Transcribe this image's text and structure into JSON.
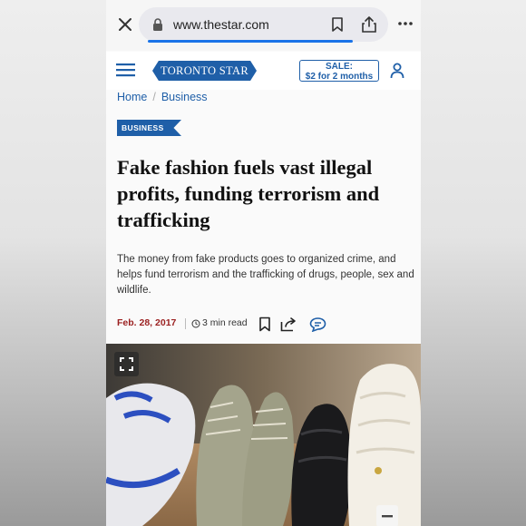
{
  "browser": {
    "url": "www.thestar.com",
    "icons": [
      "close-icon",
      "lock-icon",
      "bookmark-icon",
      "share-icon",
      "more-icon"
    ],
    "progress": 0.82
  },
  "header": {
    "logo_text": "TORONTO STAR",
    "sale_line1": "SALE:",
    "sale_line2": "$2 for 2 months",
    "brand_color": "#1f5fa8"
  },
  "breadcrumb": {
    "home": "Home",
    "separator": "/",
    "section": "Business"
  },
  "article": {
    "tag": "BUSINESS",
    "headline": "Fake fashion fuels vast illegal profits, funding terrorism and trafficking",
    "dek": "The money from fake products goes to organized crime, and helps fund terrorism and the trafficking of drugs, people, sex and wildlife.",
    "date": "Feb. 28, 2017",
    "read_time": "3 min read",
    "date_color": "#9a1f1f"
  },
  "photo": {
    "controls": [
      "expand-icon",
      "minus-icon"
    ]
  }
}
